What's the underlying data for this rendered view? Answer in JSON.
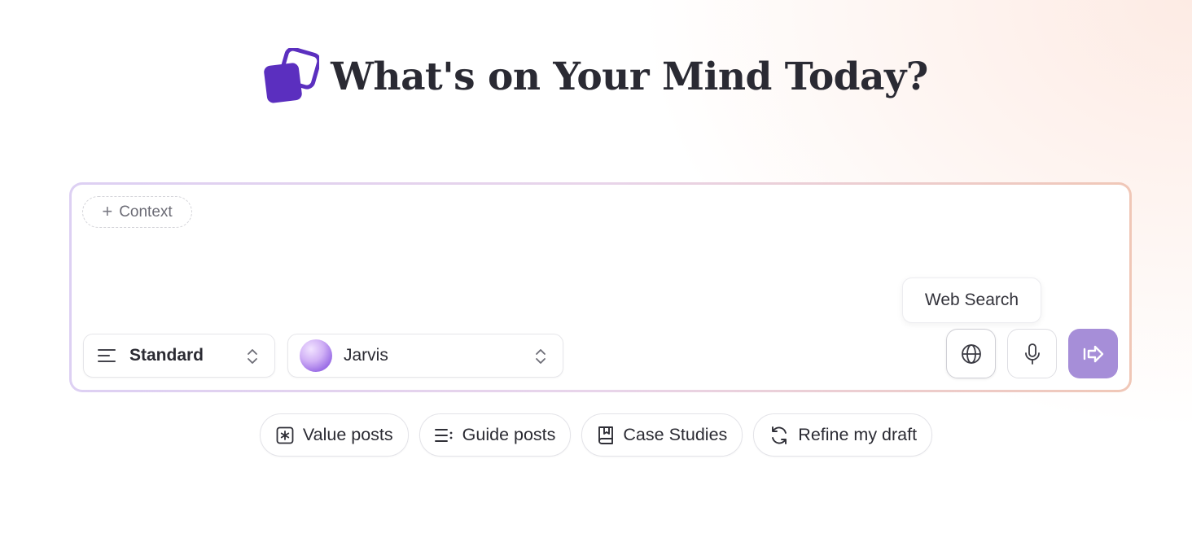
{
  "hero": {
    "title": "What's on Your Mind Today?",
    "logo_icon": "stacked-squares-logo",
    "logo_color": "#5b2fbf"
  },
  "composer": {
    "context_label": "Context",
    "context_icon": "plus-icon",
    "message_value": "",
    "mode_select": {
      "icon": "text-align-icon",
      "value": "Standard",
      "chevron": "chevron-up-down-icon"
    },
    "agent_select": {
      "avatar": "gradient-avatar",
      "value": "Jarvis",
      "chevron": "chevron-up-down-icon"
    },
    "tooltip": "Web Search",
    "buttons": {
      "web_search": {
        "icon": "globe-icon"
      },
      "voice": {
        "icon": "microphone-icon"
      },
      "send": {
        "icon": "send-arrow-icon",
        "color": "#a68ed8"
      }
    }
  },
  "suggestions": [
    {
      "label": "Value posts",
      "icon": "asterisk-box-icon"
    },
    {
      "label": "Guide posts",
      "icon": "list-icon"
    },
    {
      "label": "Case Studies",
      "icon": "book-bookmark-icon"
    },
    {
      "label": "Refine my draft",
      "icon": "refresh-icon"
    }
  ]
}
